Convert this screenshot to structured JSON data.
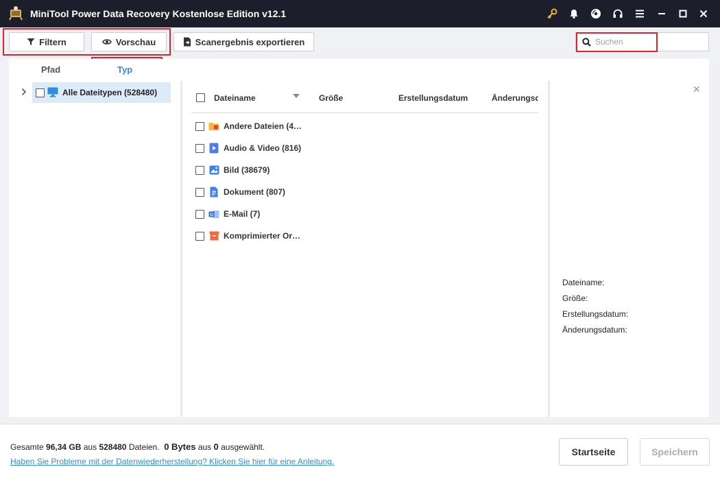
{
  "titlebar": {
    "title": "MiniTool Power Data Recovery Kostenlose Edition v12.1",
    "icons": [
      "key-icon",
      "bell-icon",
      "disc-icon",
      "headset-icon",
      "menu-icon",
      "minimize-icon",
      "maximize-icon",
      "close-icon"
    ]
  },
  "toolbar": {
    "filter_label": "Filtern",
    "preview_label": "Vorschau",
    "export_label": "Scanergebnis exportieren",
    "search_placeholder": "Suchen"
  },
  "tabs": {
    "path_label": "Pfad",
    "type_label": "Typ",
    "active": "Typ"
  },
  "tree": {
    "root_label": "Alle Dateitypen (528480)"
  },
  "columns": {
    "name": "Dateiname",
    "size": "Größe",
    "created": "Erstellungsdatum",
    "modified": "Änderungsd"
  },
  "files": [
    {
      "label": "Andere Dateien (4…",
      "icon": "folder-icon"
    },
    {
      "label": "Audio & Video (816)",
      "icon": "video-icon"
    },
    {
      "label": "Bild (38679)",
      "icon": "image-icon"
    },
    {
      "label": "Dokument (807)",
      "icon": "document-icon"
    },
    {
      "label": "E-Mail (7)",
      "icon": "email-icon"
    },
    {
      "label": "Komprimierter Or…",
      "icon": "archive-icon"
    }
  ],
  "preview_info": {
    "filename_label": "Dateiname:",
    "size_label": "Größe:",
    "created_label": "Erstellungsdatum:",
    "modified_label": "Änderungsdatum:"
  },
  "status": {
    "total_prefix": "Gesamte",
    "total_size": "96,34 GB",
    "total_mid": "aus",
    "total_count": "528480",
    "total_suffix": "Dateien.",
    "selected_size": "0 Bytes",
    "selected_mid": "aus",
    "selected_count": "0",
    "selected_suffix": "ausgewählt.",
    "help_link": "Haben Sie Probleme mit der Datenwiederherstellung? Klicken Sie hier für eine Anleitung."
  },
  "buttons": {
    "home_label": "Startseite",
    "save_label": "Speichern"
  },
  "colors": {
    "titlebar_bg": "#1d1e2c",
    "accent_blue": "#2d8ee0",
    "highlight_red": "#e0242b",
    "key_yellow": "#f3b517"
  }
}
